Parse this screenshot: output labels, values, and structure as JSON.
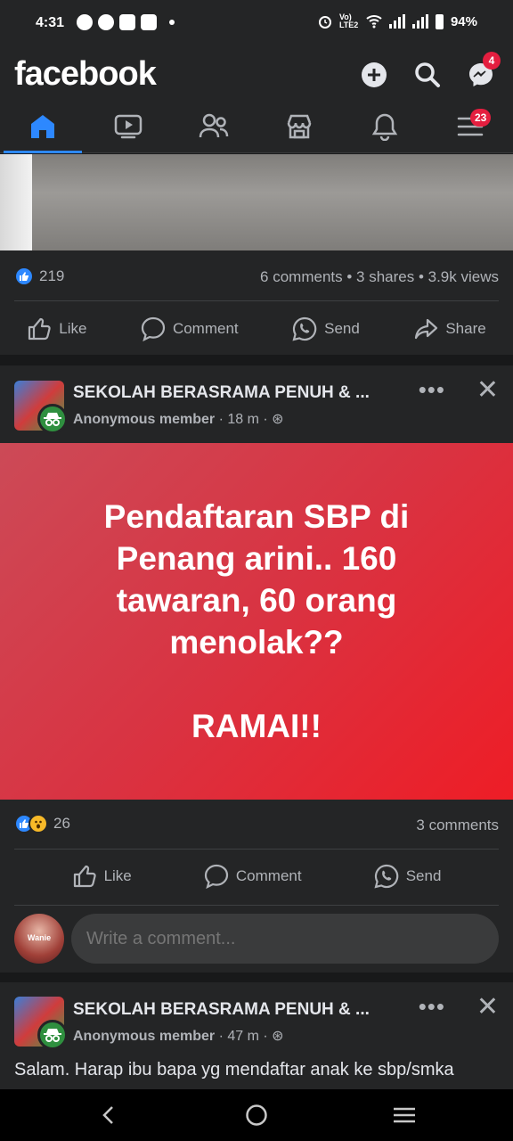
{
  "status": {
    "time": "4:31",
    "battery": "94%",
    "network": "Vo) LTE2"
  },
  "header": {
    "logo": "facebook",
    "messenger_badge": "4"
  },
  "nav": {
    "menu_badge": "23"
  },
  "post1": {
    "reactions_count": "219",
    "stats": "6 comments • 3 shares • 3.9k views",
    "actions": {
      "like": "Like",
      "comment": "Comment",
      "send": "Send",
      "share": "Share"
    }
  },
  "post2": {
    "group_name": "SEKOLAH BERASRAMA PENUH & ...",
    "author": "Anonymous member",
    "time": "· 18 m ·",
    "image_text": "Pendaftaran SBP di Penang arini.. 160 tawaran, 60 orang menolak??\n\nRAMAI!!",
    "reactions_count": "26",
    "stats": "3 comments",
    "actions": {
      "like": "Like",
      "comment": "Comment",
      "send": "Send"
    },
    "avatar_text": "Wanie",
    "comment_placeholder": "Write a comment..."
  },
  "post3": {
    "group_name": "SEKOLAH BERASRAMA PENUH & ...",
    "author": "Anonymous member",
    "time": "· 47 m ·",
    "text": "Salam. Harap ibu bapa yg mendaftar anak ke sbp/smka"
  },
  "colors": {
    "accent": "#2d88ff",
    "badge": "#e41e3f",
    "surface": "#242526",
    "background": "#18191a"
  }
}
